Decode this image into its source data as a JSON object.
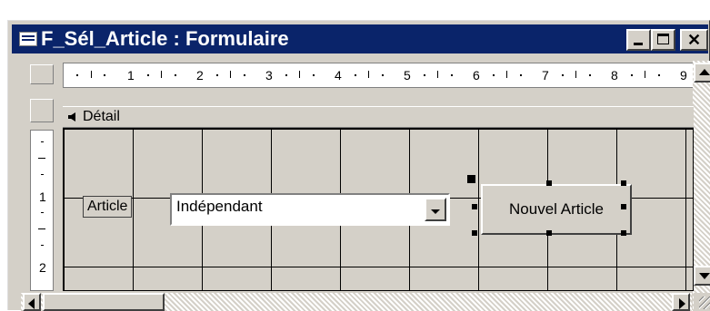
{
  "window": {
    "title": "F_Sél_Article : Formulaire",
    "controls": {
      "minimize": "minimize",
      "maximize": "maximize",
      "close": "✕"
    }
  },
  "ruler": {
    "horizontal_numbers": [
      "1",
      "2",
      "3",
      "4",
      "5",
      "6",
      "7",
      "8",
      "9"
    ],
    "vertical_numbers": [
      "1",
      "2"
    ]
  },
  "section": {
    "label": "Détail"
  },
  "form": {
    "article_label": "Article",
    "article_combo_value": "Indépendant",
    "new_article_button": "Nouvel Article"
  },
  "colors": {
    "titlebar": "#0a246a",
    "face": "#d4d0c8"
  },
  "icons": [
    "form-icon",
    "minimize-icon",
    "maximize-icon",
    "close-icon",
    "section-arrow-icon",
    "dropdown-arrow-icon",
    "scroll-up-icon",
    "scroll-down-icon",
    "scroll-left-icon",
    "scroll-right-icon",
    "size-grip-icon"
  ]
}
